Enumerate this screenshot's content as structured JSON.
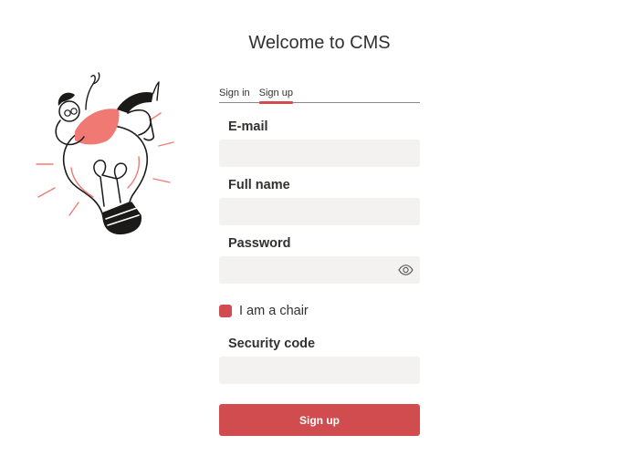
{
  "page": {
    "title": "Welcome to CMS"
  },
  "tabs": [
    {
      "label": "Sign in",
      "active": false
    },
    {
      "label": "Sign up",
      "active": true
    }
  ],
  "form": {
    "email": {
      "label": "E-mail",
      "value": "",
      "placeholder": ""
    },
    "full_name": {
      "label": "Full name",
      "value": "",
      "placeholder": ""
    },
    "password": {
      "label": "Password",
      "value": "",
      "placeholder": "",
      "toggle_icon": "eye-icon"
    },
    "chair_checkbox": {
      "label": "I am a chair",
      "checked": true
    },
    "security_code": {
      "label": "Security code",
      "value": "",
      "placeholder": ""
    },
    "submit_label": "Sign up"
  },
  "illustration": {
    "name": "person-on-lightbulb",
    "accent_color": "#f07a73"
  },
  "colors": {
    "accent": "#d14c4e",
    "input_bg": "#f3f2f1",
    "text": "#323130"
  }
}
